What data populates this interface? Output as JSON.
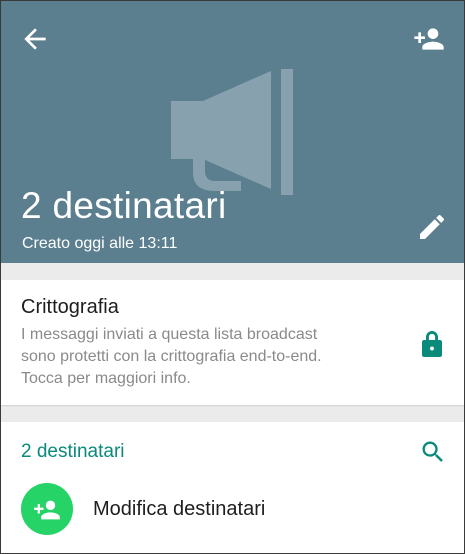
{
  "header": {
    "title": "2 destinatari",
    "subtitle": "Creato oggi alle 13:11",
    "background_color": "#5b7f8f",
    "back_icon": "arrow-back-icon",
    "add_icon": "person-add-icon",
    "edit_icon": "pencil-icon",
    "watermark_icon": "megaphone-icon"
  },
  "encryption": {
    "title": "Crittografia",
    "description_lines": [
      "I messaggi inviati a questa lista broadcast",
      "sono protetti con la crittografia end-to-end.",
      "Tocca per maggiori info."
    ],
    "icon": "lock-icon",
    "icon_color": "#0a8a7a"
  },
  "recipients": {
    "count_label": "2 destinatari",
    "search_icon": "search-icon",
    "accent_color": "#0a8a7a",
    "modify": {
      "label": "Modifica destinatari",
      "icon": "person-add-icon",
      "avatar_color": "#25d366"
    }
  }
}
